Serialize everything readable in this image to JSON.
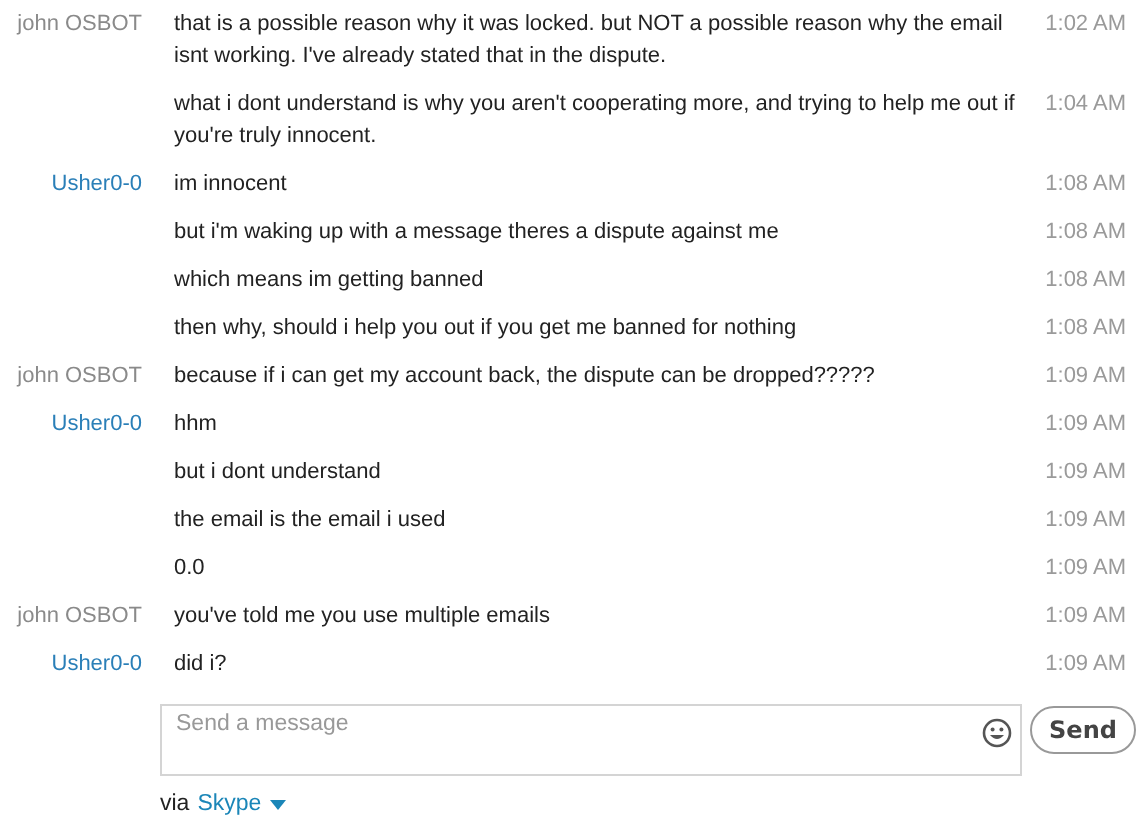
{
  "messages": [
    {
      "sender": "john OSBOT",
      "color": "#8a8a8a",
      "text": "that is a possible reason why it was locked. but NOT a possible reason why the email isnt working. I've already stated that in the dispute.",
      "time": "1:02 AM"
    },
    {
      "text": "what i dont understand is why you aren't cooperating more, and trying to help me out if you're truly innocent.",
      "time": "1:04 AM"
    },
    {
      "sender": "Usher0-0",
      "color": "#2a7fb8",
      "text": "im innocent",
      "time": "1:08 AM"
    },
    {
      "text": "but i'm waking up with a message theres a dispute against me",
      "time": "1:08 AM"
    },
    {
      "text": "which means im getting banned",
      "time": "1:08 AM"
    },
    {
      "text": "then why, should i help you out if you get me banned for nothing",
      "time": "1:08 AM"
    },
    {
      "sender": "john OSBOT",
      "color": "#8a8a8a",
      "text": "because if i can get my account back, the dispute can be dropped?????",
      "time": "1:09 AM"
    },
    {
      "sender": "Usher0-0",
      "color": "#2a7fb8",
      "text": "hhm",
      "time": "1:09 AM"
    },
    {
      "text": "but i dont understand",
      "time": "1:09 AM"
    },
    {
      "text": "the email is the email i used",
      "time": "1:09 AM"
    },
    {
      "text": "0.0",
      "time": "1:09 AM"
    },
    {
      "sender": "john OSBOT",
      "color": "#8a8a8a",
      "text": "you've told me you use multiple emails",
      "time": "1:09 AM"
    },
    {
      "sender": "Usher0-0",
      "color": "#2a7fb8",
      "text": "did i?",
      "time": "1:09 AM"
    }
  ],
  "composer": {
    "placeholder": "Send a message",
    "send_label": "Send"
  },
  "via": {
    "prefix": "via",
    "service": "Skype"
  }
}
